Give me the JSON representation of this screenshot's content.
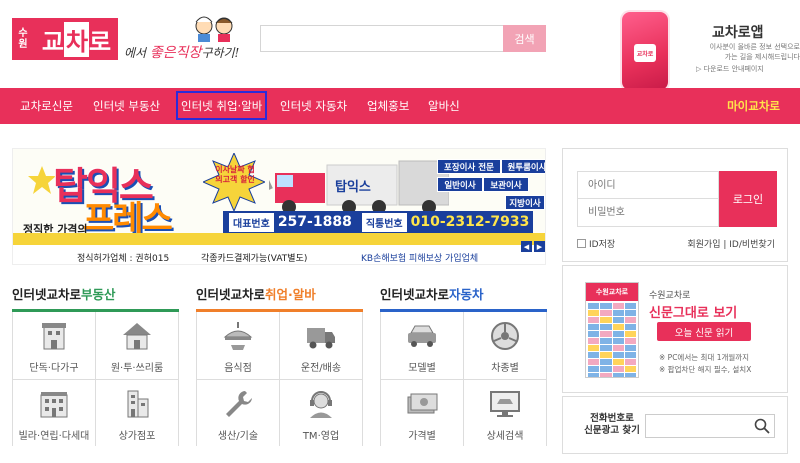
{
  "header": {
    "logo": {
      "sub_top": "수",
      "sub_bottom": "원",
      "main_a": "교",
      "main_b": "차",
      "main_c": "로"
    },
    "slogan_a": "에서 ",
    "slogan_b": "좋은직장",
    "slogan_c": "구하기!",
    "search": {
      "placeholder": "",
      "value": "",
      "button_label": "검색"
    },
    "app": {
      "title": "교차로앱",
      "desc_line1": "이사분이 올바른 정보 선택으로",
      "desc_line2": "가는 길을 제시해드립니다",
      "link": "▷ 다운로드 안내페이지",
      "phone_label": "교차로"
    }
  },
  "nav": {
    "items": [
      {
        "label": "교차로신문",
        "active": false
      },
      {
        "label": "인터넷 부동산",
        "active": false
      },
      {
        "label": "인터넷 취업·알바",
        "active": true
      },
      {
        "label": "인터넷 자동차",
        "active": false
      },
      {
        "label": "업체홍보",
        "active": false
      },
      {
        "label": "알바신",
        "active": false
      }
    ],
    "right_label": "마이교차로"
  },
  "banner": {
    "top_note": "이사날짜 협의고객 할인",
    "title1": "탑익스",
    "title2": "프레스",
    "tagline": "정직한 가격의",
    "burst": "이사날짜 협의고객 할인",
    "services": [
      "포장이사 전문",
      "원투룸이사",
      "일반이사",
      "보관이사",
      "지방이사"
    ],
    "phone_label_1": "대표번호",
    "phone_1": "257-1888",
    "phone_label_2": "직통번호",
    "phone_2": "010-2312-7933",
    "truck_brand": "탑익스",
    "foot_1": "정식허가업체 : 권허015",
    "foot_2": "각종카드결제가능(VAT별도)",
    "foot_3": "KB손해보험 피해보상 가입업체",
    "arrow_prev": "◀",
    "arrow_next": "▶"
  },
  "categories": [
    {
      "title_a": "인터넷교차로",
      "title_b": "부동산",
      "line_color": "#2f9a57",
      "items": [
        {
          "label": "단독·다가구",
          "icon": "house-icon"
        },
        {
          "label": "원·투·쓰리룸",
          "icon": "home-icon"
        },
        {
          "label": "빌라·연립·다세대",
          "icon": "building-icon"
        },
        {
          "label": "상가점포",
          "icon": "store-icon"
        }
      ]
    },
    {
      "title_a": "인터넷교차로",
      "title_b": "취업·알바",
      "line_color": "#f07f2a",
      "items": [
        {
          "label": "음식점",
          "icon": "food-icon"
        },
        {
          "label": "운전/배송",
          "icon": "truck-icon"
        },
        {
          "label": "생산/기술",
          "icon": "wrench-icon"
        },
        {
          "label": "TM·영업",
          "icon": "headset-icon"
        }
      ]
    },
    {
      "title_a": "인터넷교차로",
      "title_b": "자동차",
      "line_color": "#2a63c9",
      "items": [
        {
          "label": "모델별",
          "icon": "car-icon"
        },
        {
          "label": "차종별",
          "icon": "wheel-icon"
        },
        {
          "label": "가격별",
          "icon": "money-icon"
        },
        {
          "label": "상세검색",
          "icon": "monitor-car-icon"
        }
      ]
    }
  ],
  "login": {
    "id_placeholder": "아이디",
    "pw_placeholder": "비밀번호",
    "button_label": "로그인",
    "save_id_label": "ID저장",
    "join_label": "회원가입",
    "find_label": "ID/비번찾기",
    "separator": " | "
  },
  "paper": {
    "thumb_label": "수원교차로",
    "small_title": "수원교차로",
    "big_title": "신문그대로 보기",
    "button_label": "오늘 신문 읽기",
    "note1": "※ PC에서는 최대 1개월까지",
    "note2": "※ 팝업차단 해지 필수, 설치X"
  },
  "phone_search": {
    "label_line1": "전화번호로",
    "label_line2": "신문광고 찾기",
    "value": ""
  },
  "colors": {
    "brand": "#e8305a",
    "nav_right": "#ffe54a",
    "active_outline": "#2b2bd9"
  }
}
